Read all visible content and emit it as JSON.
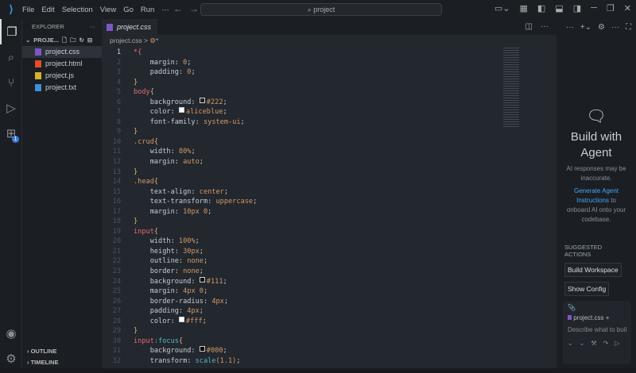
{
  "titlebar": {
    "menu": [
      "File",
      "Edit",
      "Selection",
      "View",
      "Go",
      "Run",
      "···"
    ],
    "search": "project"
  },
  "sidebar": {
    "title": "EXPLORER",
    "folder": "PROJE...",
    "files": [
      {
        "name": "project.css",
        "color": "#7e57c2",
        "glyph": "≡"
      },
      {
        "name": "project.html",
        "color": "#e44d26",
        "glyph": "5"
      },
      {
        "name": "project.js",
        "color": "#d6b12b",
        "glyph": "JS"
      },
      {
        "name": "project.txt",
        "color": "#3d8fd8",
        "glyph": "≡"
      }
    ],
    "outline": "OUTLINE",
    "timeline": "TIMELINE",
    "extensions_badge": "1"
  },
  "editor": {
    "tab": "project.css",
    "breadcrumb": "project.css",
    "breadcrumb_sep": ">",
    "breadcrumb_sym": "*",
    "lines": [
      [
        [
          "*{",
          "t-sel"
        ]
      ],
      [
        [
          "    margin: ",
          "t-prop"
        ],
        [
          "0",
          "t-val"
        ],
        [
          ";",
          "t-p"
        ]
      ],
      [
        [
          "    padding: ",
          "t-prop"
        ],
        [
          "0",
          "t-val"
        ],
        [
          ";",
          "t-p"
        ]
      ],
      [
        [
          "}",
          "t-br"
        ]
      ],
      [
        [
          "body",
          "t-sel"
        ],
        [
          "{",
          "t-br"
        ]
      ],
      [
        [
          "    background: ",
          "t-prop"
        ],
        [
          "#222",
          "t-val",
          "#222"
        ],
        [
          ";",
          "t-p"
        ]
      ],
      [
        [
          "    color: ",
          "t-prop"
        ],
        [
          "aliceblue",
          "t-val",
          "#f0f8ff"
        ],
        [
          ";",
          "t-p"
        ]
      ],
      [
        [
          "    font-family: ",
          "t-prop"
        ],
        [
          "system-ui",
          "t-val"
        ],
        [
          ";",
          "t-p"
        ]
      ],
      [
        [
          "}",
          "t-br"
        ]
      ],
      [
        [
          ".crud",
          "t-val"
        ],
        [
          "{",
          "t-br"
        ]
      ],
      [
        [
          "    width: ",
          "t-prop"
        ],
        [
          "80%",
          "t-val"
        ],
        [
          ";",
          "t-p"
        ]
      ],
      [
        [
          "    margin: ",
          "t-prop"
        ],
        [
          "auto",
          "t-val"
        ],
        [
          ";",
          "t-p"
        ]
      ],
      [
        [
          "}",
          "t-br"
        ]
      ],
      [
        [
          ".head",
          "t-val"
        ],
        [
          "{",
          "t-br"
        ]
      ],
      [
        [
          "    text-align: ",
          "t-prop"
        ],
        [
          "center",
          "t-val"
        ],
        [
          ";",
          "t-p"
        ]
      ],
      [
        [
          "    text-transform: ",
          "t-prop"
        ],
        [
          "uppercase",
          "t-val"
        ],
        [
          ";",
          "t-p"
        ]
      ],
      [
        [
          "    margin: ",
          "t-prop"
        ],
        [
          "10px 0",
          "t-val"
        ],
        [
          ";",
          "t-p"
        ]
      ],
      [
        [
          "}",
          "t-br"
        ]
      ],
      [
        [
          "input",
          "t-sel"
        ],
        [
          "{",
          "t-br"
        ]
      ],
      [
        [
          "    width: ",
          "t-prop"
        ],
        [
          "100%",
          "t-val"
        ],
        [
          ";",
          "t-p"
        ]
      ],
      [
        [
          "    height: ",
          "t-prop"
        ],
        [
          "30px",
          "t-val"
        ],
        [
          ";",
          "t-p"
        ]
      ],
      [
        [
          "    outline: ",
          "t-prop"
        ],
        [
          "none",
          "t-val"
        ],
        [
          ";",
          "t-p"
        ]
      ],
      [
        [
          "    border: ",
          "t-prop"
        ],
        [
          "none",
          "t-val"
        ],
        [
          ";",
          "t-p"
        ]
      ],
      [
        [
          "    background: ",
          "t-prop"
        ],
        [
          "#111",
          "t-val",
          "#111"
        ],
        [
          ";",
          "t-p"
        ]
      ],
      [
        [
          "    margin: ",
          "t-prop"
        ],
        [
          "4px 0",
          "t-val"
        ],
        [
          ";",
          "t-p"
        ]
      ],
      [
        [
          "    border-radius: ",
          "t-prop"
        ],
        [
          "4px",
          "t-val"
        ],
        [
          ";",
          "t-p"
        ]
      ],
      [
        [
          "    padding: ",
          "t-prop"
        ],
        [
          "4px",
          "t-val"
        ],
        [
          ";",
          "t-p"
        ]
      ],
      [
        [
          "    color: ",
          "t-prop"
        ],
        [
          "#fff",
          "t-val",
          "#fff"
        ],
        [
          ";",
          "t-p"
        ]
      ],
      [
        [
          "}",
          "t-br"
        ]
      ],
      [
        [
          "input",
          "t-sel"
        ],
        [
          ":focus",
          "t-fn"
        ],
        [
          "{",
          "t-br"
        ]
      ],
      [
        [
          "    background: ",
          "t-prop"
        ],
        [
          "#000",
          "t-val",
          "#000"
        ],
        [
          ";",
          "t-p"
        ]
      ],
      [
        [
          "    transform: ",
          "t-prop"
        ],
        [
          "scale",
          "t-fn"
        ],
        [
          "(1.1)",
          "t-val"
        ],
        [
          ";",
          "t-p"
        ]
      ]
    ]
  },
  "agent": {
    "title": "Build with Agent",
    "note": "AI responses may be inaccurate.",
    "link": "Generate Agent Instructions",
    "after_link": " to onboard AI onto your codebase.",
    "suggested": "SUGGESTED ACTIONS",
    "actions": [
      "Build Workspace",
      "Show Config"
    ],
    "context_file": "project.css",
    "placeholder": "Describe what to build"
  }
}
